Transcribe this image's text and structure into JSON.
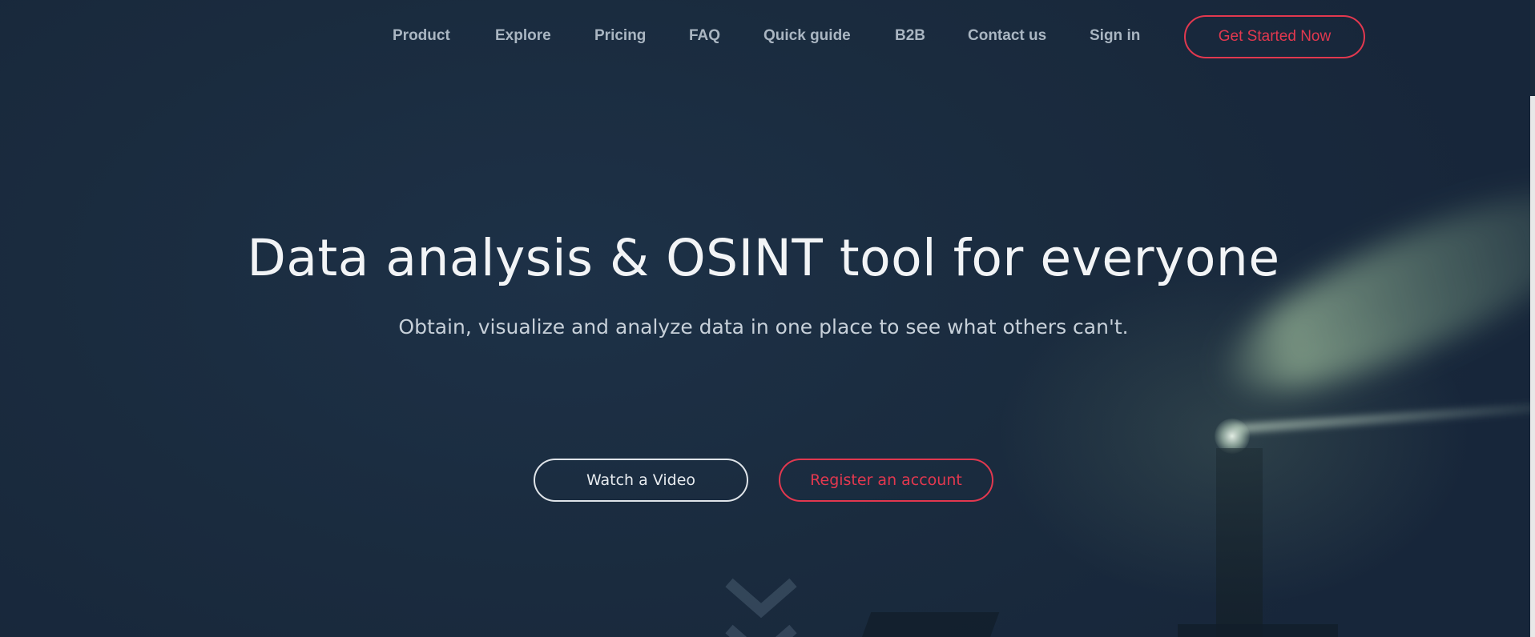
{
  "nav": {
    "items": [
      {
        "label": "Product"
      },
      {
        "label": "Explore"
      },
      {
        "label": "Pricing"
      },
      {
        "label": "FAQ"
      },
      {
        "label": "Quick guide"
      },
      {
        "label": "B2B"
      },
      {
        "label": "Contact us"
      },
      {
        "label": "Sign in"
      }
    ],
    "cta_label": "Get Started Now"
  },
  "hero": {
    "title": "Data analysis & OSINT tool for everyone",
    "subtitle": "Obtain, visualize and analyze data in one place to see what others can't.",
    "watch_video_label": "Watch a Video",
    "register_label": "Register an account"
  },
  "colors": {
    "accent": "#e2384f",
    "background": "#1a2a3d",
    "nav_text": "#aab6c2"
  },
  "icons": {
    "scroll_down": "chevron-down-icon"
  }
}
